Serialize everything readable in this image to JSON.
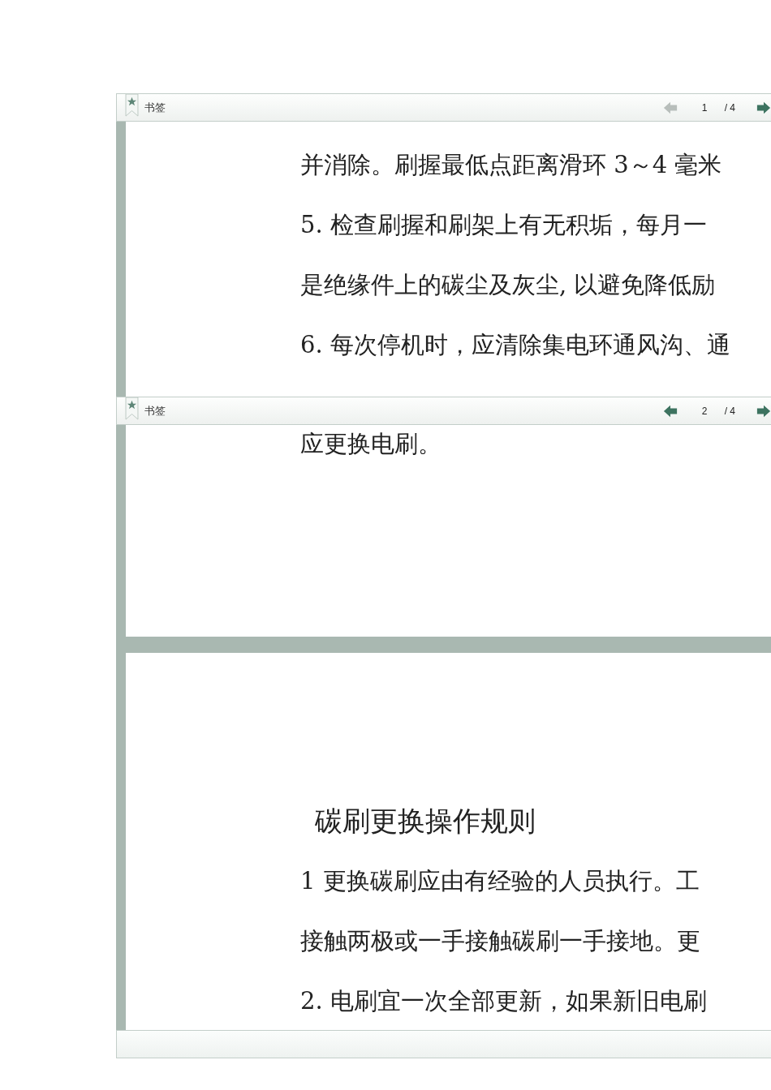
{
  "viewers": [
    {
      "bookmark_label": "书签",
      "page": "1",
      "total": "/ 4",
      "prev_disabled": true,
      "next_disabled": false,
      "lines": [
        "并消除。刷握最低点距离滑环 3～4 毫米",
        "5. 检查刷握和刷架上有无积垢，每月一",
        "是绝缘件上的碳尘及灰尘, 以避免降低励",
        "6. 每次停机时，应清除集电环通风沟、通"
      ]
    },
    {
      "bookmark_label": "书签",
      "page": "2",
      "total": "/ 4",
      "prev_disabled": false,
      "next_disabled": false,
      "lines": [
        "应更换电刷。"
      ]
    }
  ],
  "next_page": {
    "heading": "碳刷更换操作规则",
    "lines": [
      "1 更换碳刷应由有经验的人员执行。工",
      "接触两极或一手接触碳刷一手接地。更",
      "2. 电刷宜一次全部更新，如果新旧电刷"
    ]
  }
}
